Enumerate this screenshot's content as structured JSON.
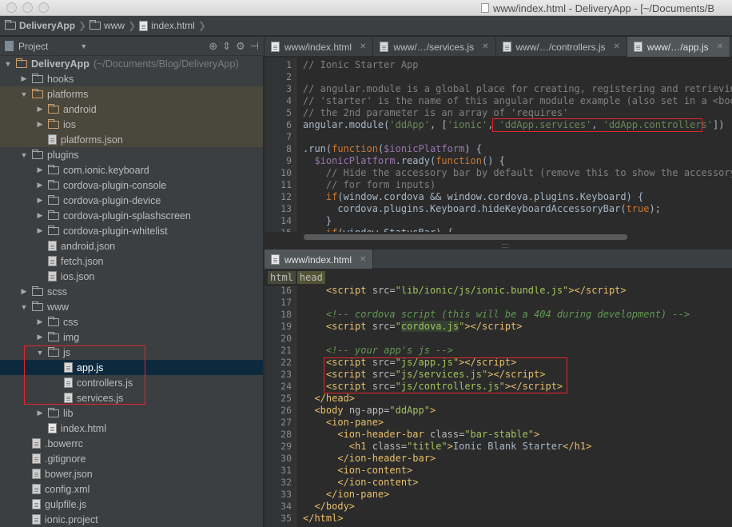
{
  "window": {
    "app_name": "DeliveryApp",
    "title": "www/index.html - DeliveryApp - [~/Documents/B"
  },
  "breadcrumbs": [
    "DeliveryApp",
    "www",
    "index.html"
  ],
  "project_panel": {
    "label": "Project",
    "view_icons": [
      "target-icon",
      "collapse-icon",
      "gear-icon",
      "hide-icon"
    ]
  },
  "tree": [
    {
      "label": "DeliveryApp",
      "extra": "(~/Documents/Blog/DeliveryApp)",
      "kind": "folder",
      "depth": 0,
      "open": true
    },
    {
      "label": "hooks",
      "kind": "folder",
      "depth": 1,
      "open": false
    },
    {
      "label": "platforms",
      "kind": "folder",
      "depth": 1,
      "open": true,
      "tint": true
    },
    {
      "label": "android",
      "kind": "folder",
      "depth": 2,
      "open": false,
      "tint": true
    },
    {
      "label": "ios",
      "kind": "folder",
      "depth": 2,
      "open": false,
      "tint": true
    },
    {
      "label": "platforms.json",
      "kind": "json",
      "depth": 2,
      "tint": true
    },
    {
      "label": "plugins",
      "kind": "folder",
      "depth": 1,
      "open": true
    },
    {
      "label": "com.ionic.keyboard",
      "kind": "folder",
      "depth": 2,
      "open": false
    },
    {
      "label": "cordova-plugin-console",
      "kind": "folder",
      "depth": 2,
      "open": false
    },
    {
      "label": "cordova-plugin-device",
      "kind": "folder",
      "depth": 2,
      "open": false
    },
    {
      "label": "cordova-plugin-splashscreen",
      "kind": "folder",
      "depth": 2,
      "open": false
    },
    {
      "label": "cordova-plugin-whitelist",
      "kind": "folder",
      "depth": 2,
      "open": false
    },
    {
      "label": "android.json",
      "kind": "json",
      "depth": 2
    },
    {
      "label": "fetch.json",
      "kind": "json",
      "depth": 2
    },
    {
      "label": "ios.json",
      "kind": "json",
      "depth": 2
    },
    {
      "label": "scss",
      "kind": "folder",
      "depth": 1,
      "open": false
    },
    {
      "label": "www",
      "kind": "folder",
      "depth": 1,
      "open": true
    },
    {
      "label": "css",
      "kind": "folder",
      "depth": 2,
      "open": false
    },
    {
      "label": "img",
      "kind": "folder",
      "depth": 2,
      "open": false
    },
    {
      "label": "js",
      "kind": "folder",
      "depth": 2,
      "open": true
    },
    {
      "label": "app.js",
      "kind": "js",
      "depth": 3,
      "selected": true
    },
    {
      "label": "controllers.js",
      "kind": "js",
      "depth": 3
    },
    {
      "label": "services.js",
      "kind": "js",
      "depth": 3
    },
    {
      "label": "lib",
      "kind": "folder",
      "depth": 2,
      "open": false
    },
    {
      "label": "index.html",
      "kind": "html",
      "depth": 2
    },
    {
      "label": ".bowerrc",
      "kind": "file",
      "depth": 1
    },
    {
      "label": ".gitignore",
      "kind": "file",
      "depth": 1
    },
    {
      "label": "bower.json",
      "kind": "json",
      "depth": 1
    },
    {
      "label": "config.xml",
      "kind": "file",
      "depth": 1
    },
    {
      "label": "gulpfile.js",
      "kind": "js",
      "depth": 1
    },
    {
      "label": "ionic.project",
      "kind": "file",
      "depth": 1
    }
  ],
  "top_tabs": [
    {
      "label": "www/index.html",
      "active": false
    },
    {
      "label": "www/…/services.js",
      "active": false
    },
    {
      "label": "www/…/controllers.js",
      "active": false
    },
    {
      "label": "www/…/app.js",
      "active": true
    }
  ],
  "bottom_tabs": [
    {
      "label": "www/index.html",
      "active": true
    }
  ],
  "html_crumbs": [
    "html",
    "head"
  ],
  "app_js_lines": [
    {
      "n": "1",
      "html": "<span class='c-cm'>// Ionic Starter App</span>"
    },
    {
      "n": "2",
      "html": ""
    },
    {
      "n": "3",
      "html": "<span class='c-cm'>// angular.module is a global place for creating, registering and retrieving Angular mod</span>"
    },
    {
      "n": "4",
      "html": "<span class='c-cm'>// 'starter' is the name of this angular module example (also set in a &lt;body&gt; attribute</span>"
    },
    {
      "n": "5",
      "html": "<span class='c-cm'>// the 2nd parameter is an array of 'requires'</span>"
    },
    {
      "n": "6",
      "html": "angular.module(<span class='c-str'>'ddApp'</span>, [<span class='c-str'>'ionic'</span>, <span class='c-str'>'ddApp.services'</span>, <span class='c-str'>'ddApp.controllers'</span>])"
    },
    {
      "n": "7",
      "html": ""
    },
    {
      "n": "8",
      "html": ".run(<span class='c-kw'>function</span>(<span class='c-prop'>$ionicPlatform</span>) {"
    },
    {
      "n": "9",
      "html": "  <span class='c-prop'>$ionicPlatform</span>.ready(<span class='c-kw'>function</span>() {"
    },
    {
      "n": "10",
      "html": "    <span class='c-cm'>// Hide the accessory bar by default (remove this to show the accessory bar above th</span>"
    },
    {
      "n": "11",
      "html": "    <span class='c-cm'>// for form inputs)</span>"
    },
    {
      "n": "12",
      "html": "    <span class='c-kw'>if</span>(window.cordova &amp;&amp; window.cordova.plugins.Keyboard) {"
    },
    {
      "n": "13",
      "html": "      cordova.plugins.Keyboard.hideKeyboardAccessoryBar(<span class='c-kw'>true</span>);"
    },
    {
      "n": "14",
      "html": "    }"
    },
    {
      "n": "15",
      "html": "    <span class='c-kw'>if</span>(window.StatusBar) {"
    }
  ],
  "index_html_lines": [
    {
      "n": "16",
      "html": "    <span class='c-tag'>&lt;script</span> <span class='c-attr'>src=</span><span class='c-aval'>\"lib/ionic/js/ionic.bundle.js\"</span><span class='c-tag'>&gt;&lt;/script&gt;</span>"
    },
    {
      "n": "17",
      "html": ""
    },
    {
      "n": "18",
      "html": "    <span class='c-htmlcm'>&lt;!-- cordova script (this will be a 404 during development) --&gt;</span>"
    },
    {
      "n": "19",
      "html": "    <span class='c-tag'>&lt;script</span> <span class='c-attr'>src=</span><span class='c-aval'>\"<span class='c-hl'>cordova.js</span>\"</span><span class='c-tag'>&gt;&lt;/script&gt;</span>"
    },
    {
      "n": "20",
      "html": ""
    },
    {
      "n": "21",
      "html": "    <span class='c-htmlcm'>&lt;!-- your app's js --&gt;</span>"
    },
    {
      "n": "22",
      "html": "    <span class='c-tag'>&lt;script</span> <span class='c-attr'>src=</span><span class='c-aval'>\"js/app.js\"</span><span class='c-tag'>&gt;&lt;/script&gt;</span>"
    },
    {
      "n": "23",
      "html": "    <span class='c-tag'>&lt;script</span> <span class='c-attr'>src=</span><span class='c-aval'>\"js/services.js\"</span><span class='c-tag'>&gt;&lt;/script&gt;</span>"
    },
    {
      "n": "24",
      "html": "    <span class='c-tag'>&lt;script</span> <span class='c-attr'>src=</span><span class='c-aval'>\"js/controllers.js\"</span><span class='c-tag'>&gt;&lt;/script&gt;</span>"
    },
    {
      "n": "25",
      "html": "  <span class='c-tag'>&lt;/head&gt;</span>"
    },
    {
      "n": "26",
      "html": "  <span class='c-tag'>&lt;body</span> <span class='c-attr'>ng-app=</span><span class='c-aval'>\"ddApp\"</span><span class='c-tag'>&gt;</span>"
    },
    {
      "n": "27",
      "html": "    <span class='c-tag'>&lt;ion-pane&gt;</span>"
    },
    {
      "n": "28",
      "html": "      <span class='c-tag'>&lt;ion-header-bar</span> <span class='c-attr'>class=</span><span class='c-aval'>\"bar-stable\"</span><span class='c-tag'>&gt;</span>"
    },
    {
      "n": "29",
      "html": "        <span class='c-tag'>&lt;h1</span> <span class='c-attr'>class=</span><span class='c-aval'>\"title\"</span><span class='c-tag'>&gt;</span>Ionic Blank Starter<span class='c-tag'>&lt;/h1&gt;</span>"
    },
    {
      "n": "30",
      "html": "      <span class='c-tag'>&lt;/ion-header-bar&gt;</span>"
    },
    {
      "n": "31",
      "html": "      <span class='c-tag'>&lt;ion-content&gt;</span>"
    },
    {
      "n": "32",
      "html": "      <span class='c-tag'>&lt;/ion-content&gt;</span>"
    },
    {
      "n": "33",
      "html": "    <span class='c-tag'>&lt;/ion-pane&gt;</span>"
    },
    {
      "n": "34",
      "html": "  <span class='c-tag'>&lt;/body&gt;</span>"
    },
    {
      "n": "35",
      "html": "<span class='c-tag'>&lt;/html&gt;</span>"
    }
  ]
}
